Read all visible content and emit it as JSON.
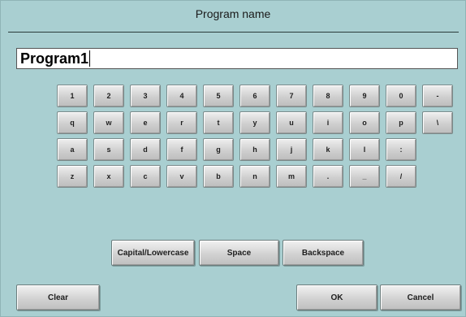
{
  "dialog": {
    "title": "Program name"
  },
  "name_field": {
    "value": "Program1"
  },
  "keyboard": {
    "rows": [
      [
        "1",
        "2",
        "3",
        "4",
        "5",
        "6",
        "7",
        "8",
        "9",
        "0",
        "-"
      ],
      [
        "q",
        "w",
        "e",
        "r",
        "t",
        "y",
        "u",
        "i",
        "o",
        "p",
        "\\"
      ],
      [
        "a",
        "s",
        "d",
        "f",
        "g",
        "h",
        "j",
        "k",
        "l",
        ":"
      ],
      [
        "z",
        "x",
        "c",
        "v",
        "b",
        "n",
        "m",
        ".",
        "_",
        "/"
      ]
    ]
  },
  "actions": {
    "capital_lowercase": "Capital/Lowercase",
    "space": "Space",
    "backspace": "Backspace"
  },
  "footer": {
    "clear": "Clear",
    "ok": "OK",
    "cancel": "Cancel"
  }
}
